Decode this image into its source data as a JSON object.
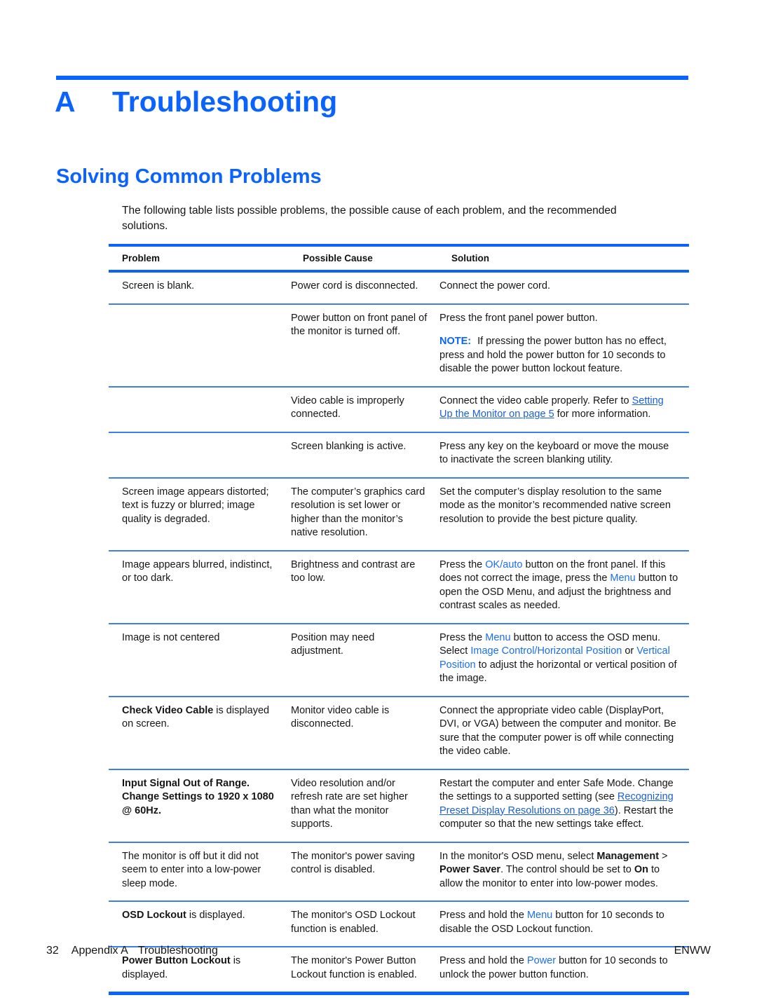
{
  "chapter": {
    "letter": "A",
    "title": "Troubleshooting"
  },
  "section": {
    "title": "Solving Common Problems",
    "intro": "The following table lists possible problems, the possible cause of each problem, and the recommended solutions."
  },
  "table": {
    "headers": {
      "problem": "Problem",
      "possible_cause": "Possible Cause",
      "solution": "Solution"
    },
    "rows": [
      {
        "problem": "Screen is blank.",
        "cause": "Power cord is disconnected.",
        "solution": "Connect the power cord."
      },
      {
        "problem": "",
        "cause": "Power button on front panel of the monitor is turned off.",
        "solution_p1": "Press the front panel power button.",
        "note_label": "NOTE:",
        "note_text": "If pressing the power button has no effect, press and hold the power button for 10 seconds to disable the power button lockout feature."
      },
      {
        "problem": "",
        "cause": "Video cable is improperly connected.",
        "solution_pre": "Connect the video cable properly. Refer to ",
        "solution_link": "Setting Up the Monitor on page 5",
        "solution_post": " for more information."
      },
      {
        "problem": "",
        "cause": "Screen blanking is active.",
        "solution": "Press any key on the keyboard or move the mouse to inactivate the screen blanking utility."
      },
      {
        "problem": "Screen image appears distorted; text is fuzzy or blurred; image quality is degraded.",
        "cause": "The computer’s graphics card resolution is set lower or higher than the monitor’s native resolution.",
        "solution": "Set the computer’s display resolution to the same mode as the monitor’s recommended native screen resolution to provide the best picture quality."
      },
      {
        "problem": "Image appears blurred, indistinct, or too dark.",
        "cause": "Brightness and contrast are too low.",
        "solution_a": "Press the ",
        "solution_ui1": "OK/auto",
        "solution_b": " button on the front panel. If this does not correct the image, press the ",
        "solution_ui2": "Menu",
        "solution_c": " button to open the OSD Menu, and adjust the brightness and contrast scales as needed."
      },
      {
        "problem": "Image is not centered",
        "cause": "Position may need adjustment.",
        "solution_a": "Press the ",
        "solution_ui1": "Menu",
        "solution_b": " button to access the OSD menu. Select ",
        "solution_ui2": "Image Control/Horizontal Position",
        "solution_c": " or ",
        "solution_ui3": "Vertical Position",
        "solution_d": " to adjust the horizontal or vertical position of the image."
      },
      {
        "problem_bold": "Check Video Cable",
        "problem_rest": " is displayed on screen.",
        "cause": "Monitor video cable is disconnected.",
        "solution": "Connect the appropriate video cable (DisplayPort, DVI, or VGA) between the computer and monitor. Be sure that the computer power is off while connecting the video cable."
      },
      {
        "problem_bold": "Input Signal Out of Range. Change Settings to 1920 x 1080 @ 60Hz",
        "problem_rest": ".",
        "cause": "Video resolution and/or refresh rate are set higher than what the monitor supports.",
        "solution_a": "Restart the computer and enter Safe Mode. Change the settings to a supported setting (see ",
        "solution_link": "Recognizing Preset Display Resolutions on page 36",
        "solution_b": "). Restart the computer so that the new settings take effect."
      },
      {
        "problem": "The monitor is off but it did not seem to enter into a low-power sleep mode.",
        "cause": "The monitor's power saving control is disabled.",
        "solution_a": "In the monitor's OSD menu, select ",
        "solution_b1": "Management",
        "solution_b": " > ",
        "solution_b2": "Power Saver",
        "solution_c": ". The control should be set to ",
        "solution_b3": "On",
        "solution_d": " to allow the monitor to enter into low-power modes."
      },
      {
        "problem_bold": "OSD Lockout",
        "problem_rest": " is displayed.",
        "cause": "The monitor's OSD Lockout function is enabled.",
        "solution_a": "Press and hold the ",
        "solution_ui1": "Menu",
        "solution_b": " button for 10 seconds to disable the OSD Lockout function."
      },
      {
        "problem_bold": "Power Button Lockout",
        "problem_rest": " is displayed.",
        "cause": "The monitor's Power Button Lockout function is enabled.",
        "solution_a": "Press and hold the ",
        "solution_ui1": "Power",
        "solution_b": " button for 10 seconds to unlock the power button function."
      }
    ]
  },
  "footer": {
    "page_number": "32",
    "appendix": "Appendix A",
    "chapter_name": "Troubleshooting",
    "locale": "ENWW"
  },
  "colors": {
    "accent_blue": "#0a62ff",
    "rule_blue": "#3b7fe8",
    "link_blue": "#1a5fd8",
    "ui_blue": "#1a6ef0"
  }
}
